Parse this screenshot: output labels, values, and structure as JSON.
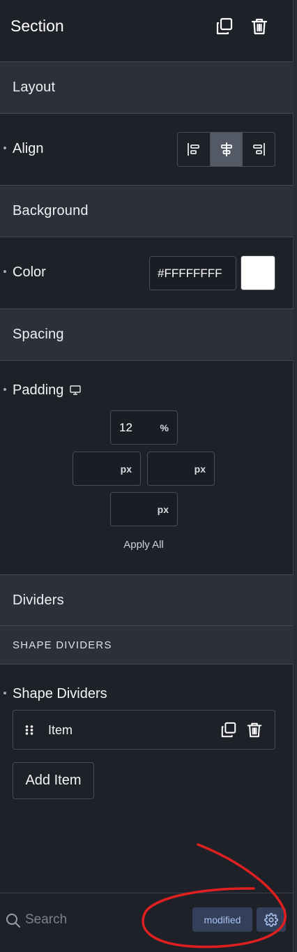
{
  "header": {
    "title": "Section"
  },
  "groups": {
    "layout": "Layout",
    "background": "Background",
    "spacing": "Spacing",
    "dividers": "Dividers",
    "shape_dividers_sub": "SHAPE DIVIDERS"
  },
  "align": {
    "label": "Align",
    "options": [
      "align-left-icon",
      "align-center-icon",
      "align-right-icon"
    ],
    "selected": "center"
  },
  "color": {
    "label": "Color",
    "value": "#FFFFFFFF",
    "swatch": "#FFFFFF"
  },
  "padding": {
    "label": "Padding",
    "device_icon": "desktop-icon",
    "top": {
      "value": "12",
      "unit": "%"
    },
    "left": {
      "value": "",
      "unit": "px"
    },
    "right": {
      "value": "",
      "unit": "px"
    },
    "bottom": {
      "value": "",
      "unit": "px"
    },
    "apply_all": "Apply All"
  },
  "shape_dividers": {
    "label": "Shape Dividers",
    "items": [
      {
        "label": "Item"
      }
    ],
    "add_label": "Add Item"
  },
  "footer": {
    "search_placeholder": "Search",
    "badge": "modified"
  },
  "colors": {
    "panel_bg": "#1f2129",
    "group_bg": "#2d3039",
    "active_segment": "#545966",
    "badge_bg": "#34405a",
    "badge_text": "#a9c3f2",
    "annotation": "#e02020"
  }
}
